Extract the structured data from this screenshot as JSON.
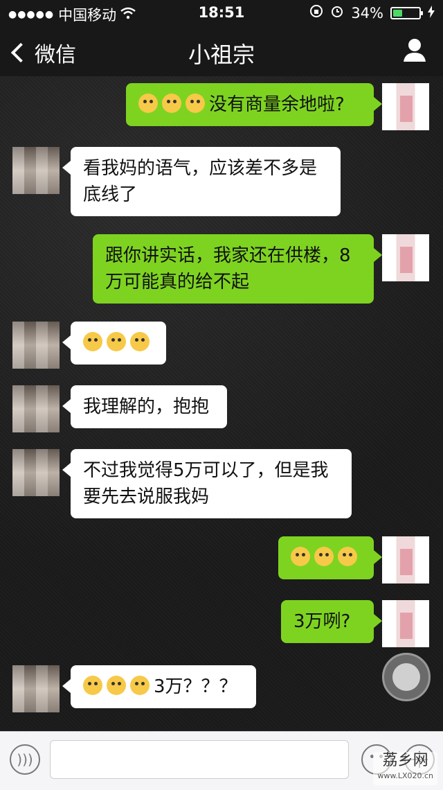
{
  "status_bar": {
    "carrier": "中国移动",
    "time": "18:51",
    "battery": "34%",
    "battery_level": 0.34
  },
  "nav": {
    "back_label": "微信",
    "title": "小祖宗"
  },
  "messages": [
    {
      "side": "out",
      "emoji": [
        "scream-emoji",
        "scream-emoji",
        "scream-emoji"
      ],
      "text": "没有商量余地啦?"
    },
    {
      "side": "in",
      "text": "看我妈的语气，应该差不多是底线了"
    },
    {
      "side": "out",
      "text": "跟你讲实话，我家还在供楼，8万可能真的给不起"
    },
    {
      "side": "in",
      "emoji": [
        "cry-emoji",
        "cry-emoji",
        "cry-emoji"
      ],
      "text": ""
    },
    {
      "side": "in",
      "text": "我理解的，抱抱"
    },
    {
      "side": "in",
      "text": "不过我觉得5万可以了，但是我要先去说服我妈"
    },
    {
      "side": "out",
      "emoji": [
        "shocked-emoji",
        "shocked-emoji",
        "shocked-emoji"
      ],
      "text": ""
    },
    {
      "side": "out",
      "text": "3万咧?"
    },
    {
      "side": "in",
      "emoji": [
        "tear-emoji",
        "tear-emoji",
        "tear-emoji"
      ],
      "text": "3万？？？"
    }
  ],
  "watermark": {
    "text": "荔乡网",
    "url": "www.LX020.cn"
  }
}
